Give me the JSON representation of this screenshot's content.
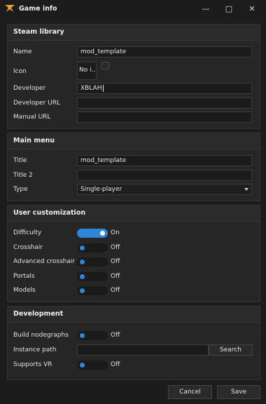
{
  "window": {
    "title": "Game info",
    "minimize": "—",
    "maximize": "□",
    "close": "✕"
  },
  "steam_library": {
    "heading": "Steam library",
    "name_label": "Name",
    "name_value": "mod_template",
    "icon_label": "Icon",
    "icon_value": "No i...",
    "developer_label": "Developer",
    "developer_value": "XBLAH",
    "developer_url_label": "Developer URL",
    "developer_url_value": "",
    "manual_url_label": "Manual URL",
    "manual_url_value": ""
  },
  "main_menu": {
    "heading": "Main menu",
    "title_label": "Title",
    "title_value": "mod_template",
    "title2_label": "Title 2",
    "title2_value": "",
    "type_label": "Type",
    "type_value": "Single-player"
  },
  "user_customization": {
    "heading": "User customization",
    "difficulty_label": "Difficulty",
    "difficulty_state": "On",
    "crosshair_label": "Crosshair",
    "crosshair_state": "Off",
    "advanced_crosshair_label": "Advanced crosshair",
    "advanced_crosshair_state": "Off",
    "portals_label": "Portals",
    "portals_state": "Off",
    "models_label": "Models",
    "models_state": "Off"
  },
  "development": {
    "heading": "Development",
    "build_nodegraphs_label": "Build nodegraphs",
    "build_nodegraphs_state": "Off",
    "instance_path_label": "Instance path",
    "instance_path_value": "",
    "search_label": "Search",
    "supports_vr_label": "Supports VR",
    "supports_vr_state": "Off"
  },
  "footer": {
    "cancel_label": "Cancel",
    "save_label": "Save"
  },
  "colors": {
    "accent": "#2d86d8",
    "background": "#1c1c1c",
    "panel": "#262626",
    "logo": "#f0a030"
  }
}
